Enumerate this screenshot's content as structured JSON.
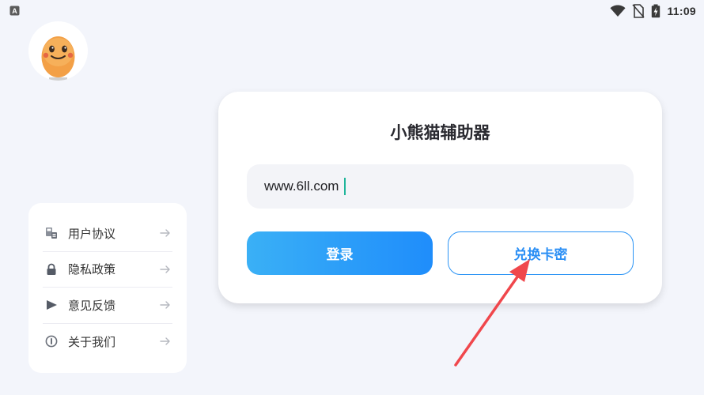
{
  "status_bar": {
    "time": "11:09",
    "icons": [
      "app-indicator-icon",
      "wifi-icon",
      "no-sim-icon",
      "battery-charging-icon"
    ]
  },
  "avatar": {
    "icon": "cartoon-face-avatar"
  },
  "menu": {
    "items": [
      {
        "label": "用户协议",
        "icon": "agreement-icon"
      },
      {
        "label": "隐私政策",
        "icon": "lock-icon"
      },
      {
        "label": "意见反馈",
        "icon": "feedback-send-icon"
      },
      {
        "label": "关于我们",
        "icon": "info-icon"
      }
    ]
  },
  "login": {
    "title": "小熊猫辅助器",
    "input_value": "www.6ll.com",
    "login_label": "登录",
    "redeem_label": "兑换卡密"
  },
  "colors": {
    "background": "#f3f5fb",
    "accent_blue": "#1f8dfb",
    "annotation_red": "#f0474c",
    "caret_teal": "#1fb59a"
  }
}
